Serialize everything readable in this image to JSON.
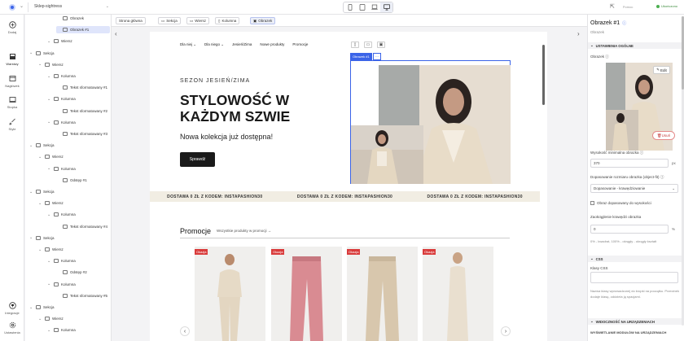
{
  "topbar": {
    "store_name": "Sklep-sightress",
    "status": "Ukończono",
    "icon_hint": "Pomoc"
  },
  "leftnav": [
    {
      "label": "Dodaj",
      "icon": "plus-circle-icon"
    },
    {
      "label": "Warstwy",
      "icon": "layers-icon"
    },
    {
      "label": "Nagłówek",
      "icon": "header-icon"
    },
    {
      "label": "Stopka",
      "icon": "footer-icon"
    },
    {
      "label": "Style",
      "icon": "brush-icon"
    },
    {
      "label": "Integracje",
      "icon": "plug-icon"
    },
    {
      "label": "Ustawienia",
      "icon": "gear-icon"
    }
  ],
  "tree": [
    {
      "label": "Obrazek",
      "indent": 3,
      "sel": false
    },
    {
      "label": "Obrazek #1",
      "indent": 3,
      "sel": true
    },
    {
      "label": "Wiersz",
      "indent": 2,
      "sel": false
    },
    {
      "label": "Sekcja",
      "indent": 0,
      "sel": false
    },
    {
      "label": "Wiersz",
      "indent": 1,
      "sel": false
    },
    {
      "label": "Kolumna",
      "indent": 2,
      "sel": false
    },
    {
      "label": "Tekst sformatowany #1",
      "indent": 3,
      "sel": false
    },
    {
      "label": "Kolumna",
      "indent": 2,
      "sel": false
    },
    {
      "label": "Tekst sformatowany #2",
      "indent": 3,
      "sel": false
    },
    {
      "label": "Kolumna",
      "indent": 2,
      "sel": false
    },
    {
      "label": "Tekst sformatowany #3",
      "indent": 3,
      "sel": false
    },
    {
      "label": "Sekcja",
      "indent": 0,
      "sel": false
    },
    {
      "label": "Wiersz",
      "indent": 1,
      "sel": false
    },
    {
      "label": "Kolumna",
      "indent": 2,
      "sel": false
    },
    {
      "label": "Odstęp #1",
      "indent": 3,
      "sel": false
    },
    {
      "label": "Sekcja",
      "indent": 0,
      "sel": false
    },
    {
      "label": "Wiersz",
      "indent": 1,
      "sel": false
    },
    {
      "label": "Kolumna",
      "indent": 2,
      "sel": false
    },
    {
      "label": "Tekst sformatowany #4",
      "indent": 3,
      "sel": false
    },
    {
      "label": "Sekcja",
      "indent": 0,
      "sel": false
    },
    {
      "label": "Wiersz",
      "indent": 1,
      "sel": false
    },
    {
      "label": "Kolumna",
      "indent": 2,
      "sel": false
    },
    {
      "label": "Odstęp #2",
      "indent": 3,
      "sel": false
    },
    {
      "label": "Kolumna",
      "indent": 2,
      "sel": false
    },
    {
      "label": "Tekst sformatowany #5",
      "indent": 3,
      "sel": false
    },
    {
      "label": "Sekcja",
      "indent": 0,
      "sel": false
    },
    {
      "label": "Wiersz",
      "indent": 1,
      "sel": false
    },
    {
      "label": "Kolumna",
      "indent": 2,
      "sel": false
    }
  ],
  "breadcrumbs": [
    "Strona główna",
    "Sekcja",
    "Wiersz",
    "Kolumna",
    "Obrazek"
  ],
  "site": {
    "nav": [
      "Dla niej ⌄",
      "Dla niego ⌄",
      "Jesień/Zima",
      "Nowe produkty",
      "Promocje"
    ],
    "hero_sub": "SEZON JESIEŃ/ZIMA",
    "hero_title": "STYLOWOŚĆ W KAŻDYM SZWIE",
    "hero_new": "Nowa kolekcja już dostępna!",
    "hero_btn": "Sprawdź",
    "selected_tag": "Obrazek #1",
    "ticker": [
      "DOSTAWA 0 ZŁ Z KODEM: INSTAPASHION30",
      "DOSTAWA 0 ZŁ Z KODEM: INSTAPASHION30",
      "DOSTAWA 0 ZŁ Z KODEM: INSTAPASHION30"
    ],
    "promo_heading": "Promocje",
    "promo_link": "Wszystkie produkty w promocji →",
    "sale_badge": "Okazja"
  },
  "panel": {
    "title": "Obrazek #1",
    "subtitle": "Obrazek",
    "section_basic": "USTAWIENIA OGÓLNE",
    "image_label": "Obrazek",
    "edit": "Edit",
    "delete": "Usuń",
    "width_label": "Wysokość minimalna obrazka",
    "width_value": "370",
    "width_unit": "px",
    "fit_label": "Dopasowanie rozmiaru obrazka (object-fit)",
    "fit_value": "Dopasowanie - krawędziowanie",
    "check_label": "Obraz dopasowany do wysokości",
    "opacity_label": "Zaokrąglenie krawędzi obrazka",
    "opacity_value": "0",
    "opacity_unit": "%",
    "opacity_note": "0% - kwadrat, 100% - okrągły - okrągły kształt",
    "section_css": "CSS",
    "css_label": "Klasy CSS",
    "css_note": "Nazwa klasy wprowadzonej do kropki na początku. Przecinek dodaje klasę, oddziela ją spacjami.",
    "section_mobile": "WIDOCZNOŚĆ NA URZĄDZENIACH",
    "mobile_label": "WYŚWIETLANIE MODUŁÓW NA URZĄDZENIACH"
  }
}
